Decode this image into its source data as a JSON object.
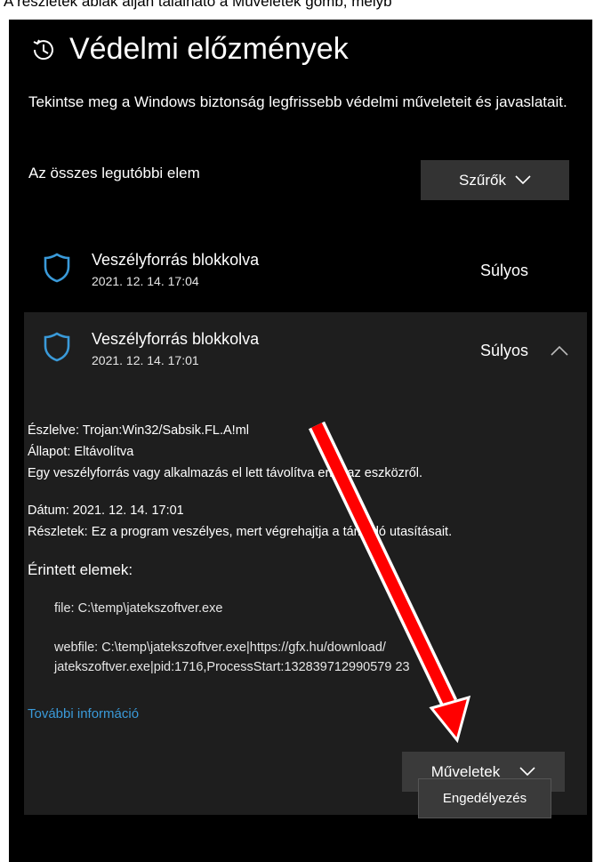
{
  "doc_text": "A részletek ablak alján található a Műveletek gomb, melyb",
  "window": {
    "title": "Védelmi előzmények",
    "description": "Tekintse meg a Windows biztonság legfrissebb védelmi műveleteit és javaslatait.",
    "section_label": "Az összes legutóbbi elem",
    "filter_label": "Szűrők"
  },
  "items": [
    {
      "title": "Veszélyforrás blokkolva",
      "date": "2021. 12. 14. 17:04",
      "severity": "Súlyos"
    },
    {
      "title": "Veszélyforrás blokkolva",
      "date": "2021. 12. 14. 17:01",
      "severity": "Súlyos"
    }
  ],
  "details": {
    "detected": "Észlelve: Trojan:Win32/Sabsik.FL.A!ml",
    "status": "Állapot: Eltávolítva",
    "status_note": "Egy veszélyforrás vagy alkalmazás el lett távolítva erről az eszközről.",
    "date": "Dátum: 2021. 12. 14. 17:01",
    "info": "Részletek: Ez a program veszélyes, mert végrehajtja a támadó utasításait.",
    "affected_title": "Érintett elemek:",
    "file": "file: C:\\temp\\jatekszoftver.exe",
    "webfile_1": "webfile: C:\\temp\\jatekszoftver.exe|https://gfx.hu/download/",
    "webfile_2": "jatekszoftver.exe|pid:1716,ProcessStart:132839712990579 23",
    "more_info": "További információ",
    "actions_label": "Műveletek",
    "menu_allow": "Engedélyezés"
  },
  "colors": {
    "accent": "#3a9ad9",
    "shield": "#3a9ad9",
    "annotation_arrow": "#ff0000"
  }
}
